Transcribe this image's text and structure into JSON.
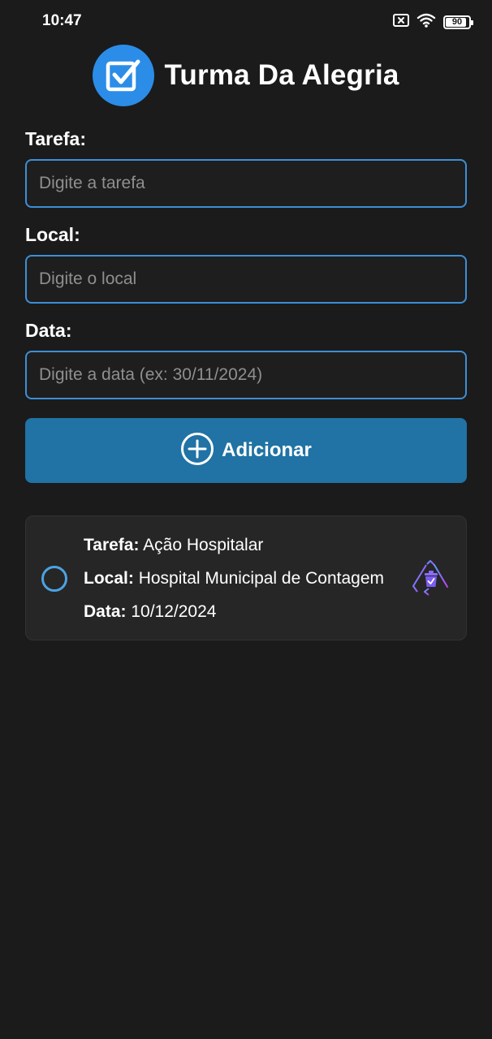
{
  "status_bar": {
    "time": "10:47",
    "battery": "90",
    "battery_level": 0.9,
    "icons": [
      "sim-off-icon",
      "wifi-icon",
      "battery-icon"
    ]
  },
  "header": {
    "title": "Turma Da Alegria",
    "logo_icon": "checkbox-check-icon",
    "accent": "#2b8de7"
  },
  "form": {
    "task": {
      "label": "Tarefa:",
      "placeholder": "Digite a tarefa",
      "value": ""
    },
    "place": {
      "label": "Local:",
      "placeholder": "Digite o local",
      "value": ""
    },
    "date": {
      "label": "Data:",
      "placeholder": "Digite a data (ex: 30/11/2024)",
      "value": ""
    },
    "add_button": {
      "label": "Adicionar",
      "icon": "plus-circle-icon",
      "color": "#2073a4"
    }
  },
  "tasks": [
    {
      "task_key": "Tarefa:",
      "task_value": "Ação Hospitalar",
      "place_key": "Local:",
      "place_value": "Hospital Municipal de Contagem",
      "date_key": "Data:",
      "date_value": "10/12/2024",
      "completed": false,
      "delete_icon": "recycle-bin-icon"
    }
  ],
  "colors": {
    "background": "#1b1b1b",
    "input_border": "#3c8fd6",
    "card": "#262626",
    "radio": "#4ba3e3"
  }
}
